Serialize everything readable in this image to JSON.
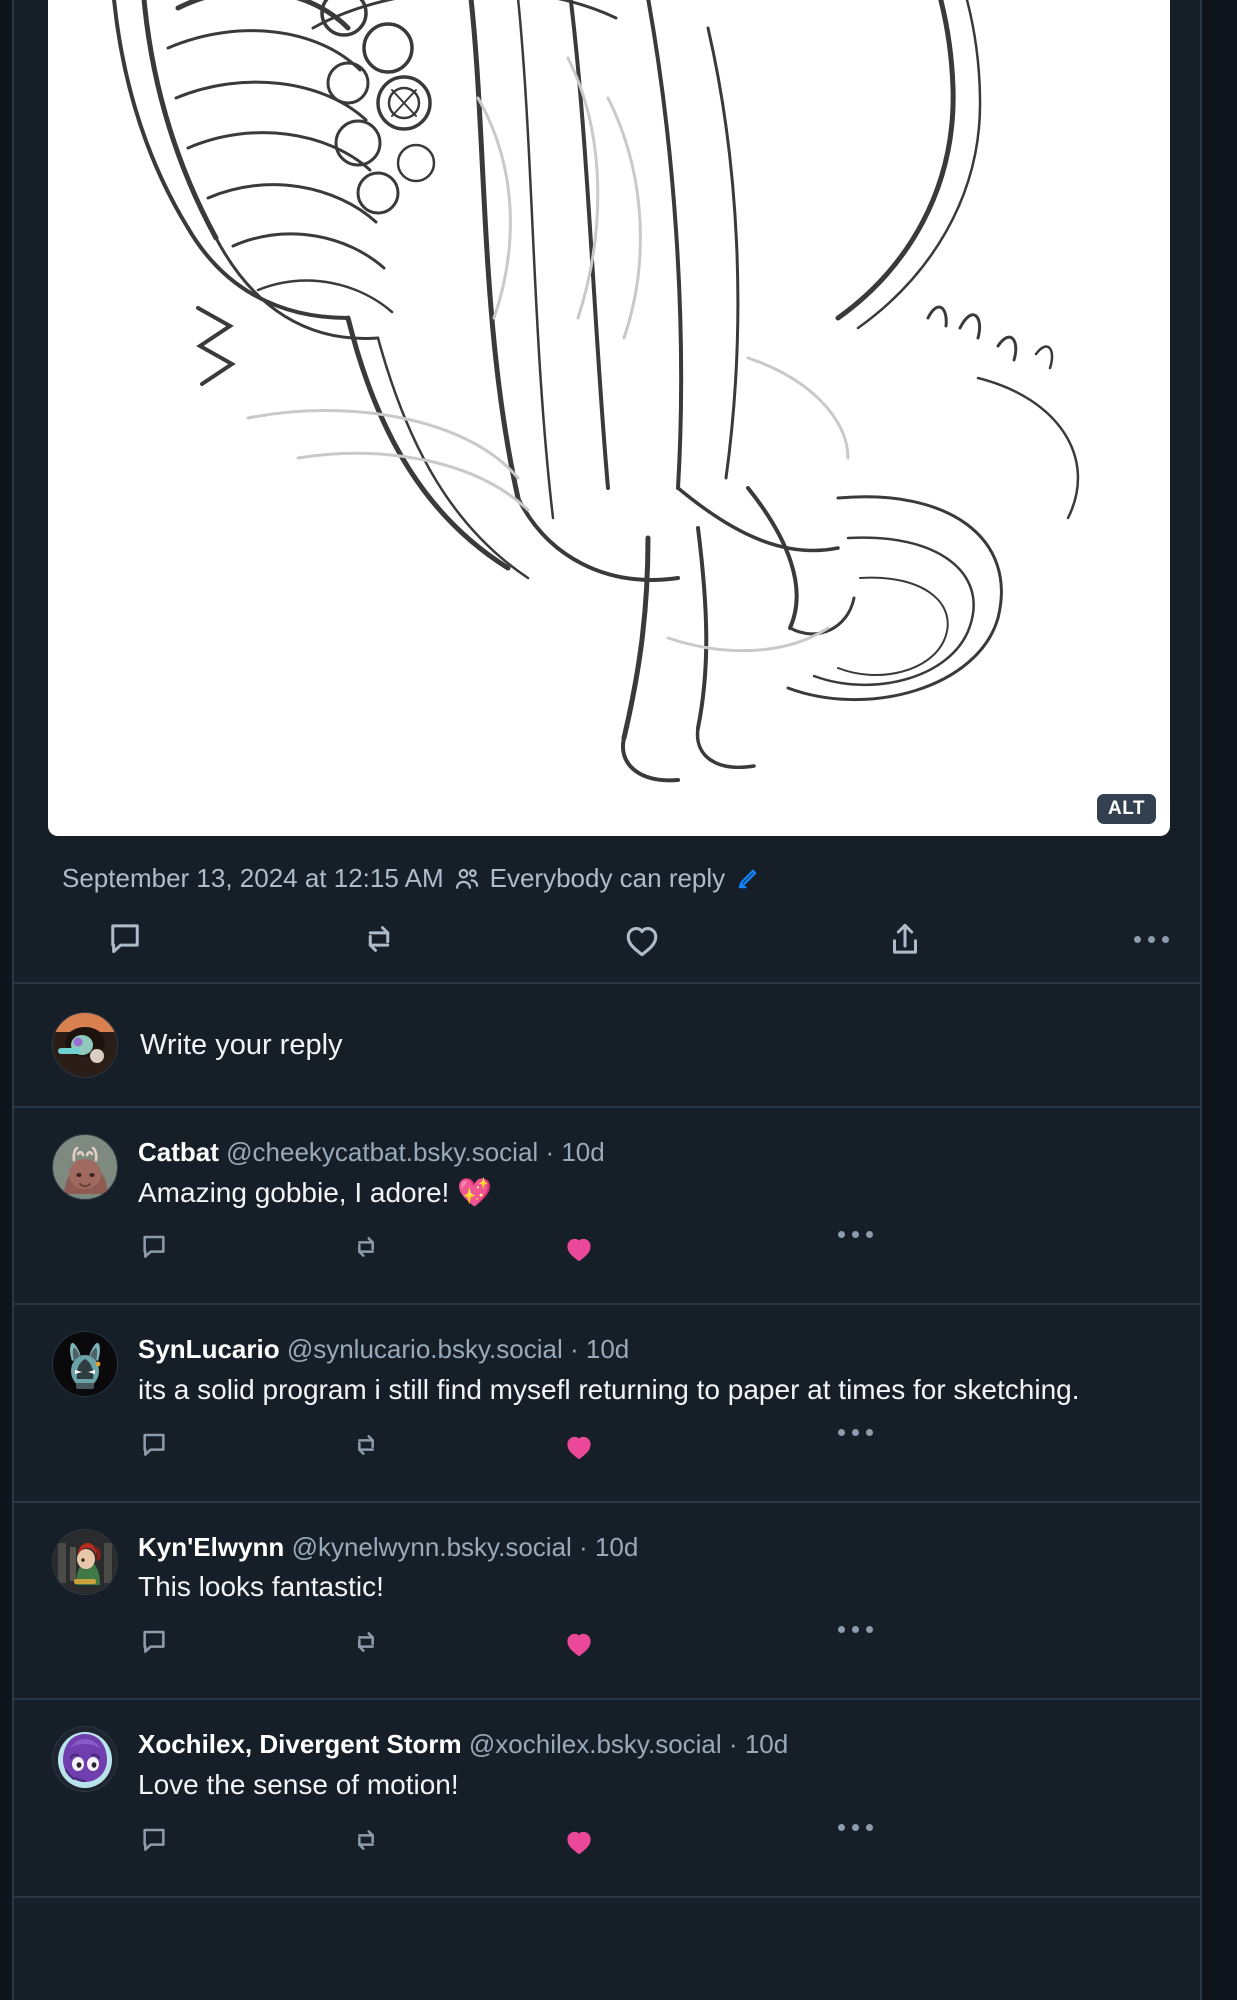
{
  "app": {
    "name": "bluesky-post-thread"
  },
  "post": {
    "image": {
      "alt_badge": "ALT",
      "alt_badge_name": "alt-text-badge"
    },
    "meta": {
      "timestamp": "September 13, 2024 at 12:15 AM",
      "audience_icon": "people-icon",
      "audience": "Everybody can reply",
      "edit_icon": "pencil-icon"
    },
    "actions": [
      {
        "name": "reply-button",
        "icon": "reply-icon",
        "label": "",
        "active": false
      },
      {
        "name": "repost-button",
        "icon": "repost-icon",
        "label": "",
        "active": false
      },
      {
        "name": "like-button",
        "icon": "heart-icon",
        "label": "",
        "active": false
      },
      {
        "name": "share-button",
        "icon": "share-icon",
        "label": "",
        "active": false
      },
      {
        "name": "more-button",
        "icon": "ellipsis-icon",
        "label": "",
        "active": false
      }
    ]
  },
  "composer": {
    "placeholder": "Write your reply",
    "avatar": "user-avatar"
  },
  "replies": [
    {
      "name": "Catbat",
      "handle": "@cheekycatbat.bsky.social",
      "dot": "·",
      "time": "10d",
      "text": "Amazing gobbie, I adore! 💖",
      "avatar": "catbat-avatar",
      "liked": true
    },
    {
      "name": "SynLucario",
      "handle": "@synlucario.bsky.social",
      "dot": "·",
      "time": "10d",
      "text": "its a solid program i still find mysefl returning to paper at times for sketching.",
      "avatar": "synlucario-avatar",
      "liked": true
    },
    {
      "name": "Kyn'Elwynn",
      "handle": "@kynelwynn.bsky.social",
      "dot": "·",
      "time": "10d",
      "text": "This looks fantastic!",
      "avatar": "kynelwynn-avatar",
      "liked": true
    },
    {
      "name": "Xochilex, Divergent Storm",
      "handle": "@xochilex.bsky.social",
      "dot": "·",
      "time": "10d",
      "text": "Love the sense of motion!",
      "avatar": "xochilex-avatar",
      "liked": true
    }
  ],
  "reply_actions": [
    {
      "name": "reply-button",
      "icon": "reply-icon"
    },
    {
      "name": "repost-button",
      "icon": "repost-icon"
    },
    {
      "name": "like-button",
      "icon": "heart-filled-icon"
    },
    {
      "name": "more-button",
      "icon": "ellipsis-icon"
    }
  ],
  "colors": {
    "background": "#0e141c",
    "surface": "#161e27",
    "border": "#2a3744",
    "text_primary": "#f2f5f8",
    "text_secondary": "#9aa9b8",
    "like_active": "#ec4899",
    "accent_blue": "#1185fe",
    "icon": "#aebbc9"
  }
}
